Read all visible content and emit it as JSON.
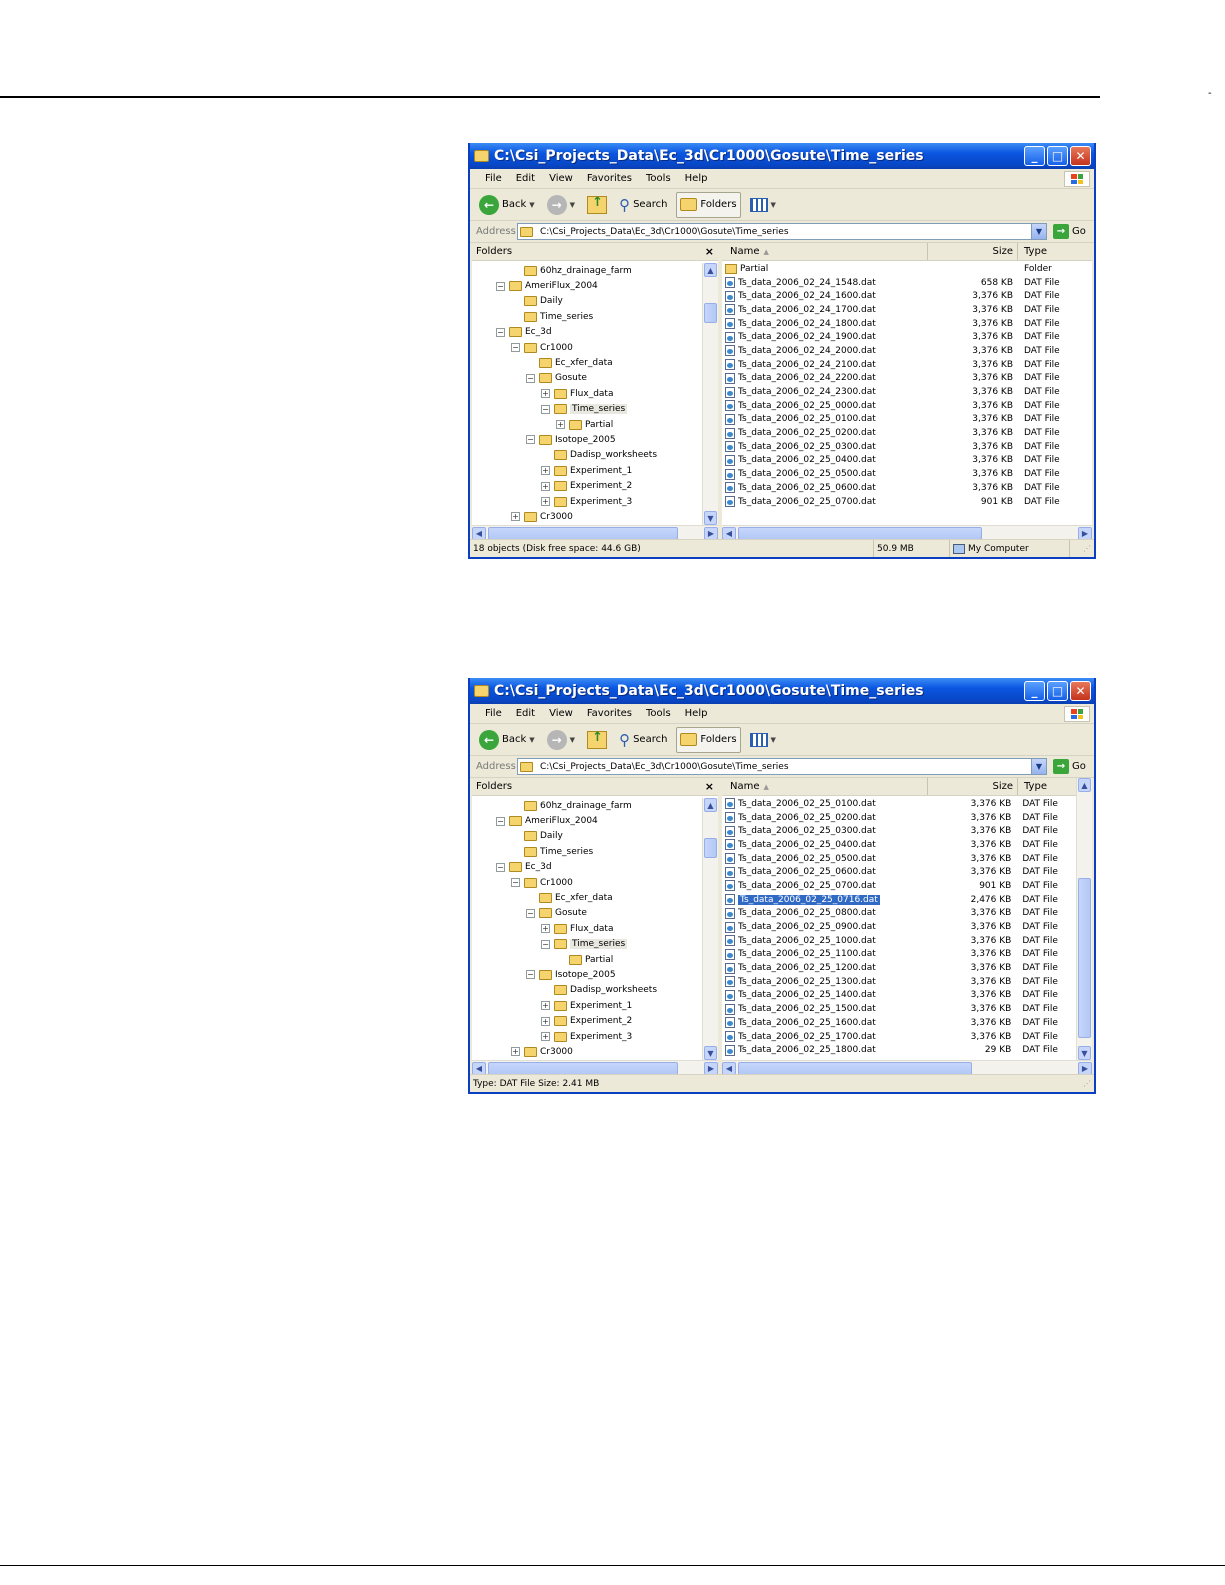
{
  "page": {
    "corner_mark": "-"
  },
  "windows": [
    {
      "title": "C:\\Csi_Projects_Data\\Ec_3d\\Cr1000\\Gosute\\Time_series",
      "menu": [
        "File",
        "Edit",
        "View",
        "Favorites",
        "Tools",
        "Help"
      ],
      "toolbar": {
        "back": "Back",
        "search": "Search",
        "folders": "Folders"
      },
      "address": {
        "label": "Address",
        "value": "C:\\Csi_Projects_Data\\Ec_3d\\Cr1000\\Gosute\\Time_series",
        "go": "Go"
      },
      "folders_pane": {
        "title": "Folders",
        "close": "×",
        "tree": [
          {
            "label": "60hz_drainage_farm",
            "level": 2,
            "expander": ""
          },
          {
            "label": "AmeriFlux_2004",
            "level": 1,
            "expander": "−"
          },
          {
            "label": "Daily",
            "level": 2,
            "expander": ""
          },
          {
            "label": "Time_series",
            "level": 2,
            "expander": ""
          },
          {
            "label": "Ec_3d",
            "level": 1,
            "expander": "−"
          },
          {
            "label": "Cr1000",
            "level": 2,
            "expander": "−"
          },
          {
            "label": "Ec_xfer_data",
            "level": 3,
            "expander": ""
          },
          {
            "label": "Gosute",
            "level": 3,
            "expander": "−"
          },
          {
            "label": "Flux_data",
            "level": 4,
            "expander": "+"
          },
          {
            "label": "Time_series",
            "level": 4,
            "expander": "−",
            "selected": true
          },
          {
            "label": "Partial",
            "level": 5,
            "expander": "+"
          },
          {
            "label": "Isotope_2005",
            "level": 3,
            "expander": "−"
          },
          {
            "label": "Dadisp_worksheets",
            "level": 4,
            "expander": ""
          },
          {
            "label": "Experiment_1",
            "level": 4,
            "expander": "+"
          },
          {
            "label": "Experiment_2",
            "level": 4,
            "expander": "+"
          },
          {
            "label": "Experiment_3",
            "level": 4,
            "expander": "+"
          },
          {
            "label": "Cr3000",
            "level": 2,
            "expander": "+"
          }
        ]
      },
      "columns": {
        "name": "Name",
        "size": "Size",
        "type": "Type"
      },
      "files": [
        {
          "name": "Partial",
          "size": "",
          "type": "Folder",
          "kind": "folder"
        },
        {
          "name": "Ts_data_2006_02_24_1548.dat",
          "size": "658 KB",
          "type": "DAT File"
        },
        {
          "name": "Ts_data_2006_02_24_1600.dat",
          "size": "3,376 KB",
          "type": "DAT File"
        },
        {
          "name": "Ts_data_2006_02_24_1700.dat",
          "size": "3,376 KB",
          "type": "DAT File"
        },
        {
          "name": "Ts_data_2006_02_24_1800.dat",
          "size": "3,376 KB",
          "type": "DAT File"
        },
        {
          "name": "Ts_data_2006_02_24_1900.dat",
          "size": "3,376 KB",
          "type": "DAT File"
        },
        {
          "name": "Ts_data_2006_02_24_2000.dat",
          "size": "3,376 KB",
          "type": "DAT File"
        },
        {
          "name": "Ts_data_2006_02_24_2100.dat",
          "size": "3,376 KB",
          "type": "DAT File"
        },
        {
          "name": "Ts_data_2006_02_24_2200.dat",
          "size": "3,376 KB",
          "type": "DAT File"
        },
        {
          "name": "Ts_data_2006_02_24_2300.dat",
          "size": "3,376 KB",
          "type": "DAT File"
        },
        {
          "name": "Ts_data_2006_02_25_0000.dat",
          "size": "3,376 KB",
          "type": "DAT File"
        },
        {
          "name": "Ts_data_2006_02_25_0100.dat",
          "size": "3,376 KB",
          "type": "DAT File"
        },
        {
          "name": "Ts_data_2006_02_25_0200.dat",
          "size": "3,376 KB",
          "type": "DAT File"
        },
        {
          "name": "Ts_data_2006_02_25_0300.dat",
          "size": "3,376 KB",
          "type": "DAT File"
        },
        {
          "name": "Ts_data_2006_02_25_0400.dat",
          "size": "3,376 KB",
          "type": "DAT File"
        },
        {
          "name": "Ts_data_2006_02_25_0500.dat",
          "size": "3,376 KB",
          "type": "DAT File"
        },
        {
          "name": "Ts_data_2006_02_25_0600.dat",
          "size": "3,376 KB",
          "type": "DAT File"
        },
        {
          "name": "Ts_data_2006_02_25_0700.dat",
          "size": "901 KB",
          "type": "DAT File"
        }
      ],
      "status": {
        "objects": "18 objects (Disk free space: 44.6 GB)",
        "size": "50.9 MB",
        "location": "My Computer"
      }
    },
    {
      "title": "C:\\Csi_Projects_Data\\Ec_3d\\Cr1000\\Gosute\\Time_series",
      "menu": [
        "File",
        "Edit",
        "View",
        "Favorites",
        "Tools",
        "Help"
      ],
      "toolbar": {
        "back": "Back",
        "search": "Search",
        "folders": "Folders"
      },
      "address": {
        "label": "Address",
        "value": "C:\\Csi_Projects_Data\\Ec_3d\\Cr1000\\Gosute\\Time_series",
        "go": "Go"
      },
      "folders_pane": {
        "title": "Folders",
        "close": "×",
        "tree": [
          {
            "label": "60hz_drainage_farm",
            "level": 2,
            "expander": ""
          },
          {
            "label": "AmeriFlux_2004",
            "level": 1,
            "expander": "−"
          },
          {
            "label": "Daily",
            "level": 2,
            "expander": ""
          },
          {
            "label": "Time_series",
            "level": 2,
            "expander": ""
          },
          {
            "label": "Ec_3d",
            "level": 1,
            "expander": "−"
          },
          {
            "label": "Cr1000",
            "level": 2,
            "expander": "−"
          },
          {
            "label": "Ec_xfer_data",
            "level": 3,
            "expander": ""
          },
          {
            "label": "Gosute",
            "level": 3,
            "expander": "−"
          },
          {
            "label": "Flux_data",
            "level": 4,
            "expander": "+"
          },
          {
            "label": "Time_series",
            "level": 4,
            "expander": "−",
            "selected": true
          },
          {
            "label": "Partial",
            "level": 5,
            "expander": ""
          },
          {
            "label": "Isotope_2005",
            "level": 3,
            "expander": "−"
          },
          {
            "label": "Dadisp_worksheets",
            "level": 4,
            "expander": ""
          },
          {
            "label": "Experiment_1",
            "level": 4,
            "expander": "+"
          },
          {
            "label": "Experiment_2",
            "level": 4,
            "expander": "+"
          },
          {
            "label": "Experiment_3",
            "level": 4,
            "expander": "+"
          },
          {
            "label": "Cr3000",
            "level": 2,
            "expander": "+"
          }
        ]
      },
      "columns": {
        "name": "Name",
        "size": "Size",
        "type": "Type"
      },
      "files": [
        {
          "name": "Ts_data_2006_02_25_0100.dat",
          "size": "3,376 KB",
          "type": "DAT File"
        },
        {
          "name": "Ts_data_2006_02_25_0200.dat",
          "size": "3,376 KB",
          "type": "DAT File"
        },
        {
          "name": "Ts_data_2006_02_25_0300.dat",
          "size": "3,376 KB",
          "type": "DAT File"
        },
        {
          "name": "Ts_data_2006_02_25_0400.dat",
          "size": "3,376 KB",
          "type": "DAT File"
        },
        {
          "name": "Ts_data_2006_02_25_0500.dat",
          "size": "3,376 KB",
          "type": "DAT File"
        },
        {
          "name": "Ts_data_2006_02_25_0600.dat",
          "size": "3,376 KB",
          "type": "DAT File"
        },
        {
          "name": "Ts_data_2006_02_25_0700.dat",
          "size": "901 KB",
          "type": "DAT File"
        },
        {
          "name": "Ts_data_2006_02_25_0716.dat",
          "size": "2,476 KB",
          "type": "DAT File",
          "selected": true
        },
        {
          "name": "Ts_data_2006_02_25_0800.dat",
          "size": "3,376 KB",
          "type": "DAT File"
        },
        {
          "name": "Ts_data_2006_02_25_0900.dat",
          "size": "3,376 KB",
          "type": "DAT File"
        },
        {
          "name": "Ts_data_2006_02_25_1000.dat",
          "size": "3,376 KB",
          "type": "DAT File"
        },
        {
          "name": "Ts_data_2006_02_25_1100.dat",
          "size": "3,376 KB",
          "type": "DAT File"
        },
        {
          "name": "Ts_data_2006_02_25_1200.dat",
          "size": "3,376 KB",
          "type": "DAT File"
        },
        {
          "name": "Ts_data_2006_02_25_1300.dat",
          "size": "3,376 KB",
          "type": "DAT File"
        },
        {
          "name": "Ts_data_2006_02_25_1400.dat",
          "size": "3,376 KB",
          "type": "DAT File"
        },
        {
          "name": "Ts_data_2006_02_25_1500.dat",
          "size": "3,376 KB",
          "type": "DAT File"
        },
        {
          "name": "Ts_data_2006_02_25_1600.dat",
          "size": "3,376 KB",
          "type": "DAT File"
        },
        {
          "name": "Ts_data_2006_02_25_1700.dat",
          "size": "3,376 KB",
          "type": "DAT File"
        },
        {
          "name": "Ts_data_2006_02_25_1800.dat",
          "size": "29 KB",
          "type": "DAT File"
        }
      ],
      "status": {
        "objects": "Type: DAT File Size: 2.41 MB",
        "size": "",
        "location": ""
      }
    }
  ]
}
